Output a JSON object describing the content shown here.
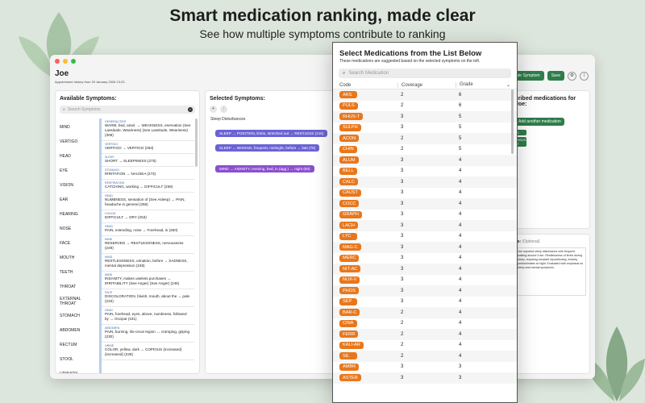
{
  "hero": {
    "title": "Smart medication ranking, made clear",
    "subtitle": "See how multiple symptoms contribute to ranking"
  },
  "window": {
    "patient_name": "Joe",
    "appointment": "Appointment history from 20 January 2026 13:23",
    "back": "‹",
    "create_symptom": "Create Symptom",
    "save": "Save",
    "gear_icon": "gear-icon",
    "info_icon": "info-icon"
  },
  "available": {
    "title": "Available Symptoms:",
    "search_placeholder": "Search Symptoms",
    "categories": [
      "MIND",
      "VERTIGO",
      "HEAD",
      "EYE",
      "VISION",
      "EAR",
      "HEARING",
      "NOSE",
      "FACE",
      "MOUTH",
      "TEETH",
      "THROAT",
      "EXTERNAL THROAT",
      "STOMACH",
      "ABDOMEN",
      "RECTUM",
      "STOOL",
      "URINARY"
    ],
    "rubrics": [
      {
        "cat": "GENERALITIES",
        "text": "WARM, bed, amel. → WEAKNESS, enervation (See Lassitude, Weariness) (See Lassitude, Weariness) (309)"
      },
      {
        "cat": "VERTIGO",
        "text": "VERTIGO → VERTIGO (283)"
      },
      {
        "cat": "SLEEP",
        "text": "SHORT → SLEEPINESS (275)"
      },
      {
        "cat": "STOMACH",
        "text": "IRRITATION → NAUSEA (273)"
      },
      {
        "cat": "RESPIRATION",
        "text": "CATCHING, working → DIFFICULT (259)"
      },
      {
        "cat": "HEAD",
        "text": "NUMBNESS, sensation of (See Asleep) → PAIN, headache in general (258)"
      },
      {
        "cat": "COUGH",
        "text": "DIFFICULT → DRY (253)"
      },
      {
        "cat": "HEAD",
        "text": "PAIN, extending, nose → Forehead, in (250)"
      },
      {
        "cat": "MIND",
        "text": "RESERVED → RESTLESSNESS, nervousness (249)"
      },
      {
        "cat": "MIND",
        "text": "RESTLESSNESS, urination, before → SADNESS, mental depression (249)"
      },
      {
        "cat": "MIND",
        "text": "INSANITY, makes useless purchases → IRRITABILITY (See Anger) (See Anger) (245)"
      },
      {
        "cat": "FACE",
        "text": "DISCOLORATION, bluish, mouth, about the → pale (233)"
      },
      {
        "cat": "HEAD",
        "text": "PAIN, forehead, eyes, above, numbness, followed by → Occiput (231)"
      },
      {
        "cat": "ABDOMEN",
        "text": "PAIN, burning, ilio-cecal region → cramping, griping (230)"
      },
      {
        "cat": "URINE",
        "text": "COLOR, yellow, dark → COPIOUS (increased) (increased) (228)"
      }
    ]
  },
  "selected": {
    "title": "Selected Symptoms:",
    "add_icon": "plus-icon",
    "group_icon": "group-icon",
    "section": "Sleep Disturbances",
    "chips": [
      {
        "text": "SLEEP → POSITION, limbs, stretched out → RESTLESS (215)",
        "color": "blue"
      },
      {
        "text": "SLEEP → WAKING, frequent, midnight, before → late (78)",
        "color": "blue"
      },
      {
        "text": "MIND → ANXIETY, evening, bed, in (agg.) → night (93)",
        "color": "purple"
      }
    ]
  },
  "prescribed": {
    "title": "cribed medications for Joe:",
    "add_button": "Add another medication",
    "tags": [
      "S",
      "BHUS-T"
    ]
  },
  "notes": {
    "title": "es:",
    "optional": "(Optional)",
    "text": "Joe reported sleep disturbance with frequent waking around 3 am. Restlessness of limbs during sleep, requiring constant repositioning. Anxiety predominates at night. Evaluated with emphasis on sleep and mental symptoms."
  },
  "modal": {
    "title": "Select Medications from the List Below",
    "subtitle": "These medications are suggested based on the selected symptoms on the left.",
    "search_placeholder": "Search Medication",
    "col_code": "Code",
    "col_coverage": "Coverage",
    "col_grade": "Grade",
    "sort_icon": "chevron-down-icon",
    "rows": [
      {
        "code": "ARS",
        "coverage": "2",
        "grade": "6"
      },
      {
        "code": "PULS",
        "coverage": "2",
        "grade": "6"
      },
      {
        "code": "RHUS-T",
        "coverage": "3",
        "grade": "5"
      },
      {
        "code": "SULPH",
        "coverage": "3",
        "grade": "5"
      },
      {
        "code": "ACON",
        "coverage": "2",
        "grade": "5"
      },
      {
        "code": "CHIN",
        "coverage": "2",
        "grade": "5"
      },
      {
        "code": "ALUM",
        "coverage": "3",
        "grade": "4"
      },
      {
        "code": "BELL",
        "coverage": "3",
        "grade": "4"
      },
      {
        "code": "CALC",
        "coverage": "3",
        "grade": "4"
      },
      {
        "code": "CAUST",
        "coverage": "3",
        "grade": "4"
      },
      {
        "code": "COCC",
        "coverage": "3",
        "grade": "4"
      },
      {
        "code": "GRAPH",
        "coverage": "3",
        "grade": "4"
      },
      {
        "code": "LACH",
        "coverage": "3",
        "grade": "4"
      },
      {
        "code": "LYC",
        "coverage": "3",
        "grade": "4"
      },
      {
        "code": "MAG-C",
        "coverage": "3",
        "grade": "4"
      },
      {
        "code": "MERC",
        "coverage": "3",
        "grade": "4"
      },
      {
        "code": "NIT-AC",
        "coverage": "3",
        "grade": "4"
      },
      {
        "code": "NUX-V",
        "coverage": "3",
        "grade": "4"
      },
      {
        "code": "PHOS",
        "coverage": "3",
        "grade": "4"
      },
      {
        "code": "SEP",
        "coverage": "3",
        "grade": "4"
      },
      {
        "code": "BAR-C",
        "coverage": "2",
        "grade": "4"
      },
      {
        "code": "CINA",
        "coverage": "2",
        "grade": "4"
      },
      {
        "code": "FERR",
        "coverage": "2",
        "grade": "4"
      },
      {
        "code": "KALI-AR",
        "coverage": "2",
        "grade": "4"
      },
      {
        "code": "SIL",
        "coverage": "2",
        "grade": "4"
      },
      {
        "code": "AMBR",
        "coverage": "3",
        "grade": "3"
      },
      {
        "code": "ASTER",
        "coverage": "3",
        "grade": "3"
      }
    ]
  },
  "colors": {
    "accent_green": "#2e7d4a",
    "code_orange": "#e8771c",
    "chip_blue": "#6a63d4",
    "chip_purple": "#8a4fcf"
  }
}
